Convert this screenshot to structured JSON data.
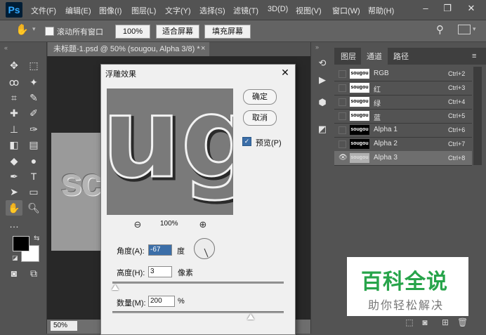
{
  "app": {
    "logo": "Ps"
  },
  "menu": [
    "文件(F)",
    "编辑(E)",
    "图像(I)",
    "图层(L)",
    "文字(Y)",
    "选择(S)",
    "滤镜(T)",
    "3D(D)",
    "视图(V)",
    "窗口(W)",
    "帮助(H)"
  ],
  "window_controls": {
    "minimize": "–",
    "restore": "❐",
    "close": "✕"
  },
  "options_bar": {
    "scroll_all_windows": "滚动所有窗口",
    "zoom_value": "100%",
    "fit_screen": "适合屏幕",
    "fill_screen": "填充屏幕"
  },
  "document": {
    "tab_title": "未标题-1.psd @ 50% (sougou, Alpha 3/8) *",
    "close": "×",
    "canvas_text": "sc",
    "status_zoom": "50%"
  },
  "panel": {
    "tabs": [
      "图层",
      "通道",
      "路径"
    ],
    "active_tab": "通道",
    "channels": [
      {
        "name": "RGB",
        "shortcut": "Ctrl+2",
        "thumb": "sougou",
        "dark": false,
        "visible": false
      },
      {
        "name": "红",
        "shortcut": "Ctrl+3",
        "thumb": "sougou",
        "dark": false,
        "visible": false
      },
      {
        "name": "绿",
        "shortcut": "Ctrl+4",
        "thumb": "sougou",
        "dark": false,
        "visible": false
      },
      {
        "name": "蓝",
        "shortcut": "Ctrl+5",
        "thumb": "sougou",
        "dark": false,
        "visible": false
      },
      {
        "name": "Alpha 1",
        "shortcut": "Ctrl+6",
        "thumb": "sougou",
        "dark": true,
        "visible": false
      },
      {
        "name": "Alpha 2",
        "shortcut": "Ctrl+7",
        "thumb": "sougou",
        "dark": true,
        "visible": false
      },
      {
        "name": "Alpha 3",
        "shortcut": "Ctrl+8",
        "thumb": "sougou",
        "dark": false,
        "visible": true
      }
    ]
  },
  "dialog": {
    "title": "浮雕效果",
    "close": "✕",
    "preview_text": "ug",
    "ok": "确定",
    "cancel": "取消",
    "preview_label": "预览(P)",
    "preview_checked": true,
    "zoom_percent": "100%",
    "angle_label": "角度(A):",
    "angle_value": "-67",
    "angle_unit": "度",
    "height_label": "高度(H):",
    "height_value": "3",
    "height_unit": "像素",
    "amount_label": "数量(M):",
    "amount_value": "200",
    "amount_unit": "%"
  },
  "watermark": {
    "title": "百科全说",
    "subtitle": "助你轻松解决"
  },
  "colors": {
    "accent": "#3b6ea8",
    "watermark_green": "#27a44a",
    "chrome": "#535353"
  }
}
